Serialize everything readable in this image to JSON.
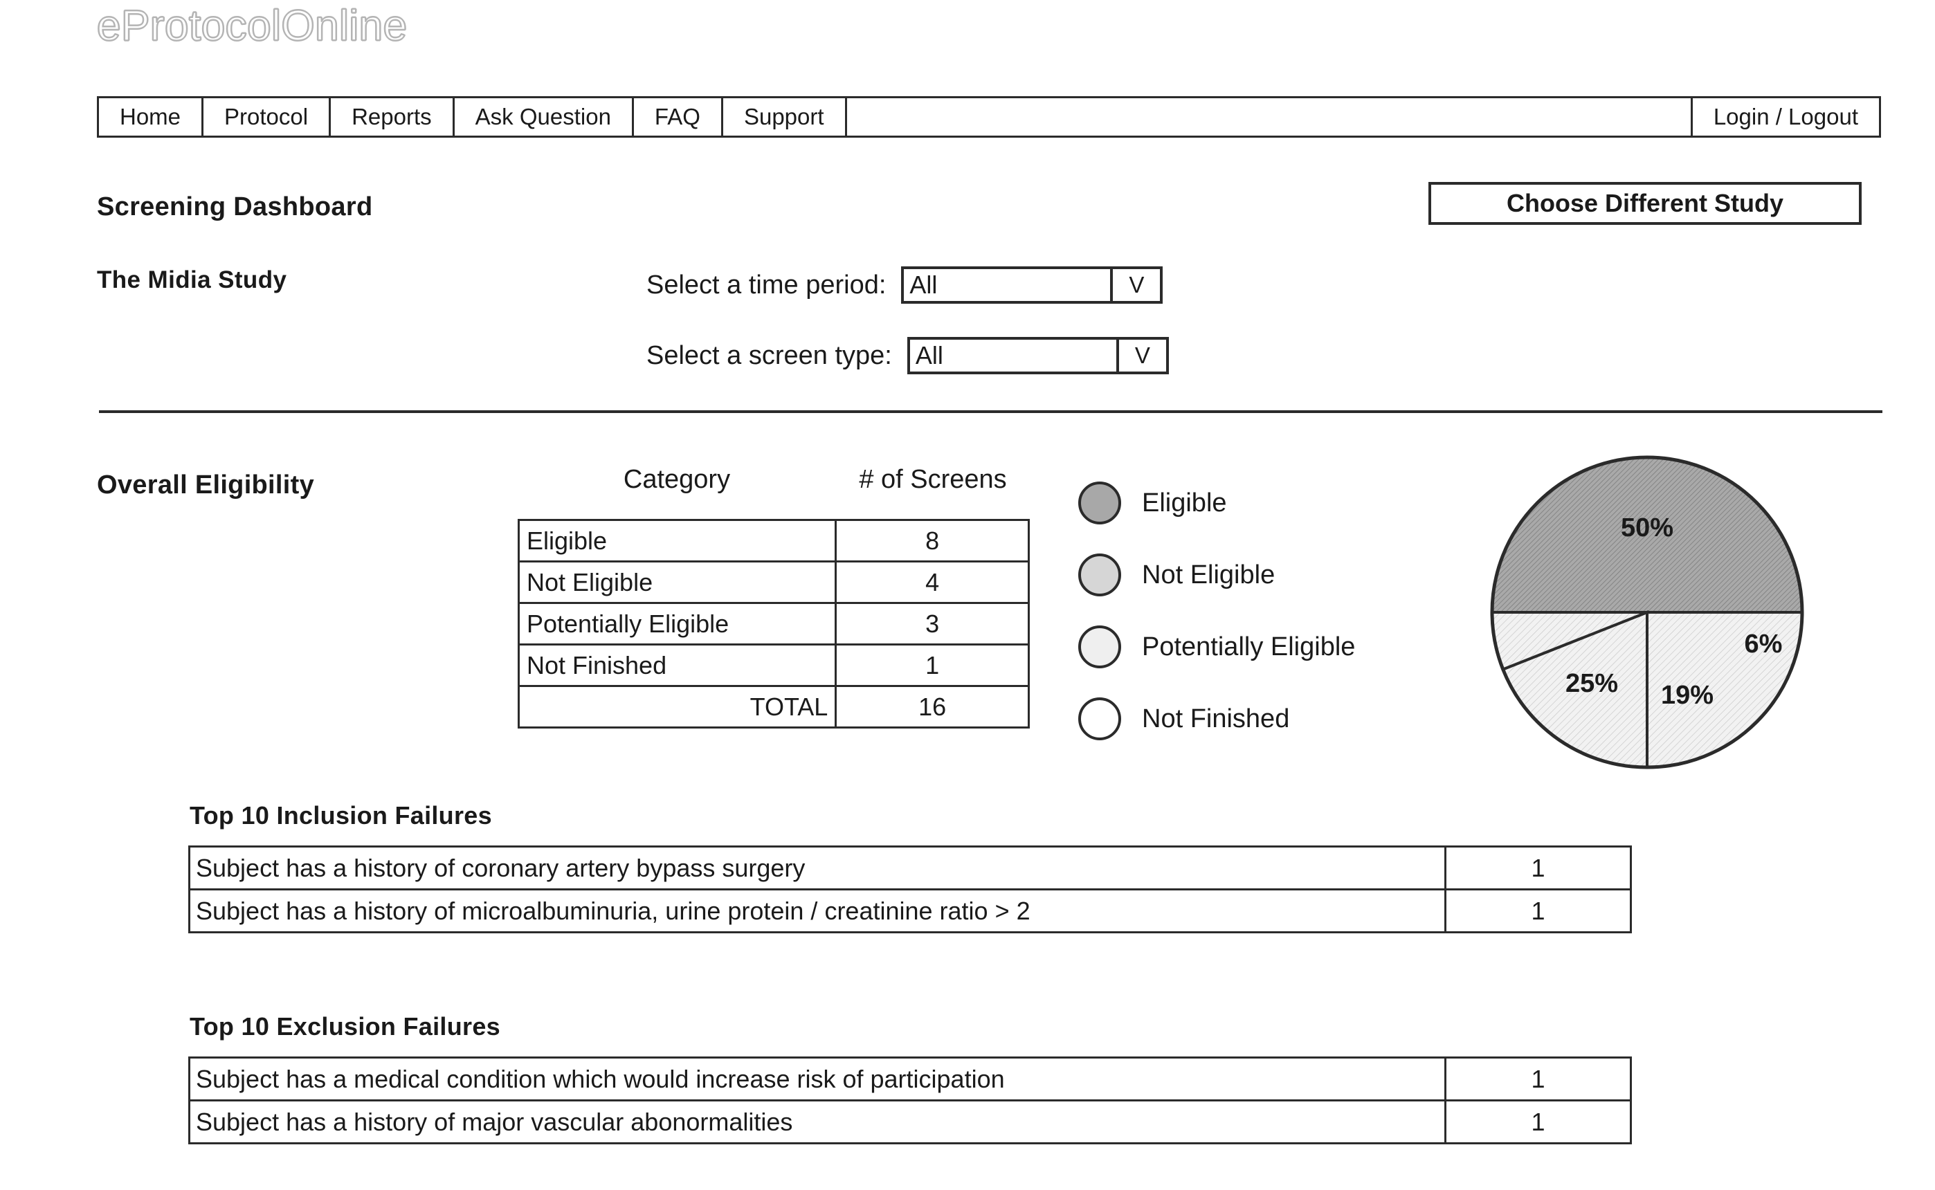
{
  "masthead": {
    "title": "eProtocolOnline"
  },
  "nav": {
    "items": [
      {
        "label": "Home",
        "name": "nav-item-home"
      },
      {
        "label": "Protocol",
        "name": "nav-item-protocol"
      },
      {
        "label": "Reports",
        "name": "nav-item-reports"
      },
      {
        "label": "Ask Question",
        "name": "nav-item-ask-question"
      },
      {
        "label": "FAQ",
        "name": "nav-item-faq"
      },
      {
        "label": "Support",
        "name": "nav-item-support"
      }
    ],
    "login_label": "Login / Logout"
  },
  "header": {
    "page_title": "Screening Dashboard",
    "choose_study_label": "Choose Different Study",
    "study_name": "The Midia Study"
  },
  "filters": {
    "time_period": {
      "label": "Select a time period:",
      "value": "All",
      "arrow": "V"
    },
    "screen_type": {
      "label": "Select a screen type:",
      "value": "All",
      "arrow": "V"
    }
  },
  "overall_eligibility": {
    "label": "Overall Eligibility",
    "columns": {
      "category": "Category",
      "screens": "# of Screens"
    },
    "rows": [
      {
        "category": "Eligible",
        "screens": "8"
      },
      {
        "category": "Not Eligible",
        "screens": "4"
      },
      {
        "category": "Potentially Eligible",
        "screens": "3"
      },
      {
        "category": "Not Finished",
        "screens": "1"
      }
    ],
    "total": {
      "category": "TOTAL",
      "screens": "16"
    }
  },
  "legend": {
    "items": [
      {
        "label": "Eligible",
        "color": "#a8a8a8"
      },
      {
        "label": "Not Eligible",
        "color": "#d6d6d6"
      },
      {
        "label": "Potentially Eligible",
        "color": "#efefef"
      },
      {
        "label": "Not Finished",
        "color": "#ffffff"
      }
    ]
  },
  "chart_data": {
    "type": "pie",
    "title": "Overall Eligibility",
    "labels": [
      "Eligible",
      "Not Eligible",
      "Potentially Eligible",
      "Not Finished"
    ],
    "values": [
      8,
      4,
      3,
      1
    ],
    "percent_labels": [
      "50%",
      "25%",
      "19%",
      "6%"
    ],
    "percents": [
      50,
      25,
      19,
      6
    ],
    "colors": [
      "#a8a8a8",
      "#efefef",
      "#efefef",
      "#efefef"
    ],
    "legend_position": "left",
    "grid": false
  },
  "inclusion_failures": {
    "title": "Top 10 Inclusion Failures",
    "rows": [
      {
        "description": "Subject has a history of coronary artery bypass surgery",
        "count": "1"
      },
      {
        "description": "Subject has a history of microalbuminuria, urine protein / creatinine ratio > 2",
        "count": "1"
      }
    ]
  },
  "exclusion_failures": {
    "title": "Top 10 Exclusion Failures",
    "rows": [
      {
        "description": "Subject has a medical condition which would increase risk of participation",
        "count": "1"
      },
      {
        "description": "Subject has a history of major vascular abonormalities",
        "count": "1"
      }
    ]
  }
}
